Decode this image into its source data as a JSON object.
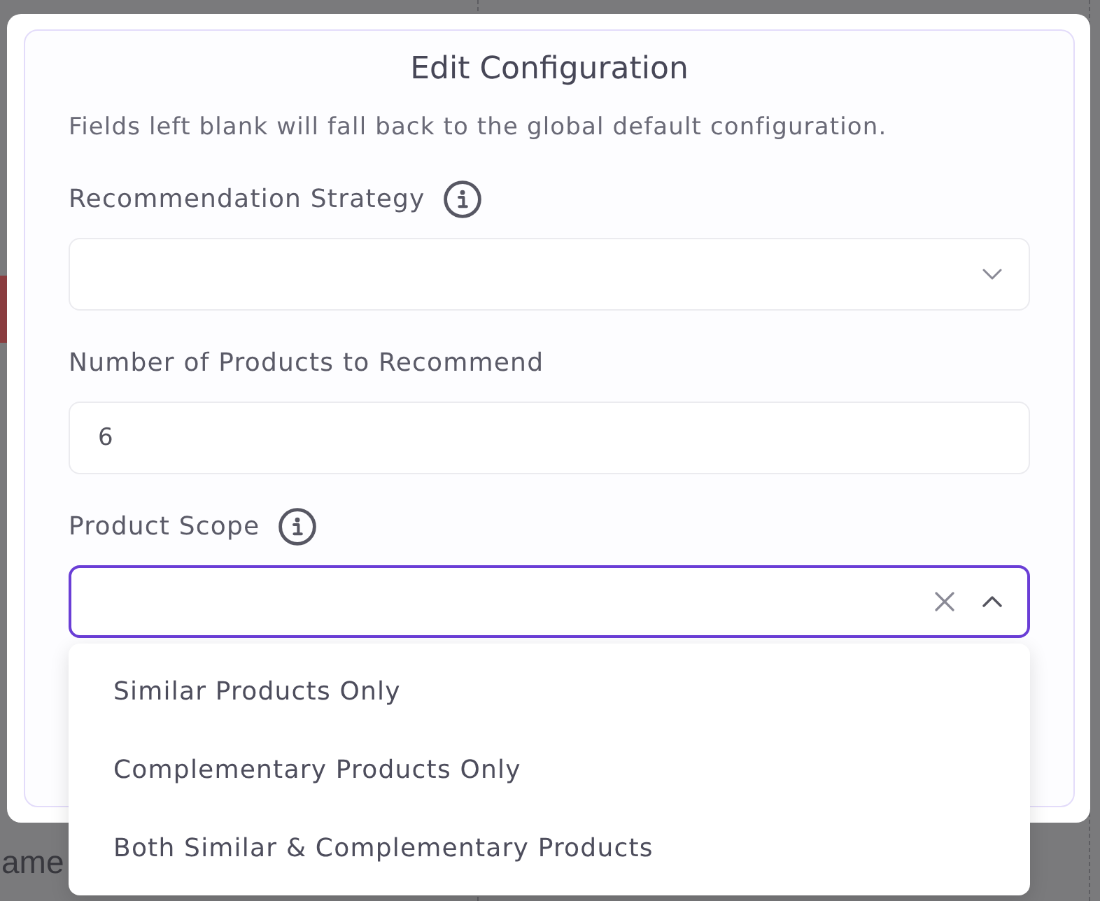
{
  "background": {
    "text": "ame"
  },
  "dialog": {
    "title": "Edit Configuration",
    "description": "Fields left blank will fall back to the global default configuration.",
    "fields": [
      {
        "kind": "select",
        "label": "Recommendation Strategy",
        "info": true,
        "focused": false,
        "expanded": false,
        "clear_button": false
      },
      {
        "kind": "input",
        "label": "Number of Products to Recommend",
        "focused": false,
        "value": "6"
      },
      {
        "kind": "select",
        "label": "Product Scope",
        "info": true,
        "focused": true,
        "expanded": true,
        "clear_button": true,
        "options": [
          {
            "label": "Similar Products Only",
            "selected": false
          },
          {
            "label": "Complementary Products Only",
            "selected": false
          },
          {
            "label": "Both Similar & Complementary Products",
            "selected": false
          }
        ]
      }
    ]
  }
}
